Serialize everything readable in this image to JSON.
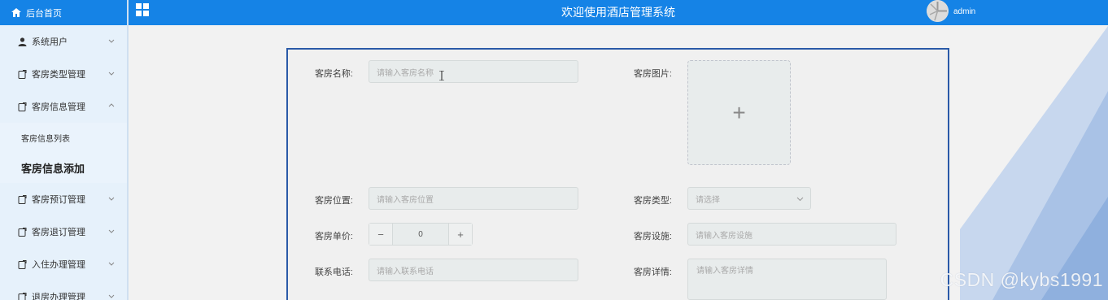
{
  "sidebar": {
    "home_label": "后台首页",
    "items": [
      {
        "label": "系统用户"
      },
      {
        "label": "客房类型管理"
      },
      {
        "label": "客房信息管理"
      },
      {
        "label": "客房预订管理"
      },
      {
        "label": "客房退订管理"
      },
      {
        "label": "入住办理管理"
      },
      {
        "label": "退房办理管理"
      }
    ],
    "sub_items": [
      {
        "label": "客房信息列表"
      },
      {
        "label": "客房信息添加"
      }
    ]
  },
  "header": {
    "title": "欢迎使用酒店管理系统",
    "username": "admin"
  },
  "form": {
    "name": {
      "label": "客房名称:",
      "placeholder": "请输入客房名称"
    },
    "image": {
      "label": "客房图片:",
      "plus": "+"
    },
    "location": {
      "label": "客房位置:",
      "placeholder": "请输入客房位置"
    },
    "type": {
      "label": "客房类型:",
      "placeholder": "请选择"
    },
    "price": {
      "label": "客房单价:",
      "value": "0",
      "minus": "−",
      "plus": "+"
    },
    "facilities": {
      "label": "客房设施:",
      "placeholder": "请输入客房设施"
    },
    "phone": {
      "label": "联系电话:",
      "placeholder": "请输入联系电话"
    },
    "details": {
      "label": "客房详情:",
      "placeholder": "请输入客房详情"
    }
  },
  "watermark": "CSDN @kybs1991",
  "colors": {
    "header": "#1583e6",
    "sidebar": "#e6f1fb",
    "card_border": "#2a5aa8"
  }
}
